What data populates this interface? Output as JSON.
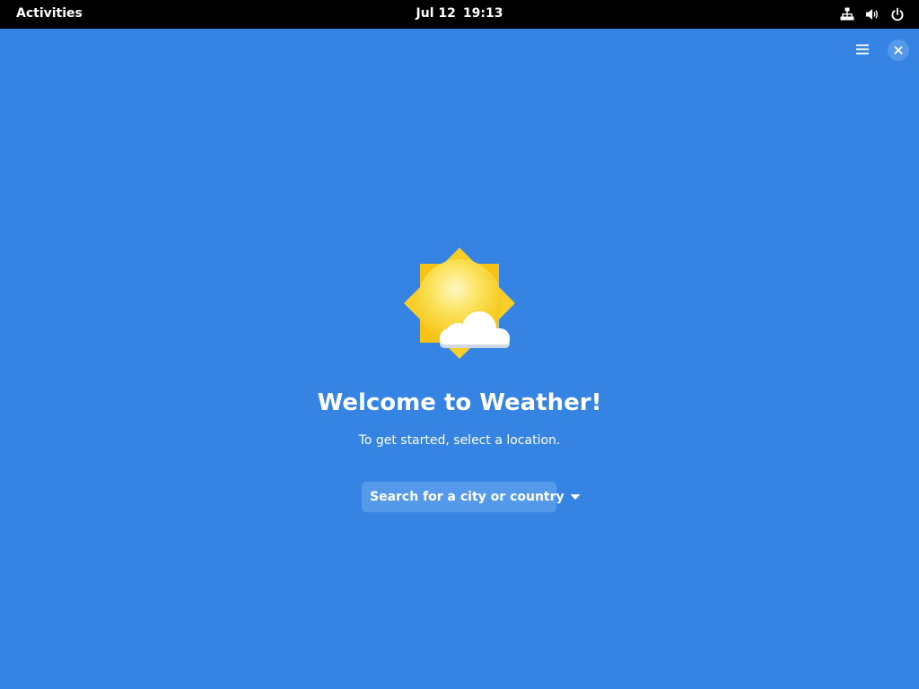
{
  "topbar": {
    "activities_label": "Activities",
    "date": "Jul 12",
    "time": "19:13",
    "tray_icons": [
      "network-wired-icon",
      "volume-icon",
      "power-icon"
    ]
  },
  "window": {
    "background_color": "#3584e4",
    "header_buttons": [
      "hamburger-menu-icon",
      "close-icon"
    ]
  },
  "welcome": {
    "icon": "weather-few-clouds-icon",
    "title": "Welcome to Weather!",
    "subtitle": "To get started, select a location.",
    "search_button_label": "Search for a city or country"
  }
}
